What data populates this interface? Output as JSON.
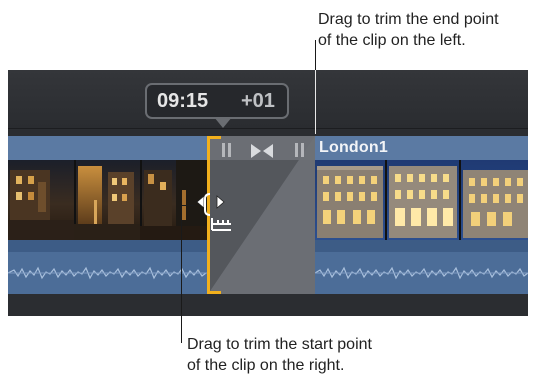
{
  "callouts": {
    "end_point_line1": "Drag to trim the end point",
    "end_point_line2": "of the clip on the left.",
    "start_point_line1": "Drag to trim the start point",
    "start_point_line2": "of the clip on the right."
  },
  "timeline": {
    "timecode": "09:15",
    "offset": "+01",
    "right_clip_name": "London1"
  },
  "colors": {
    "trim_edge": "#f2b01d",
    "clip_blue": "#3d5c86",
    "clip_header": "#5b7aa3",
    "timeline_bg": "#2b2d31"
  },
  "icons": {
    "transition_handles": "pause-bars-icon",
    "transition_bowtie": "bowtie-transition-icon",
    "trim_cursor": "trim-cursor-icon"
  }
}
